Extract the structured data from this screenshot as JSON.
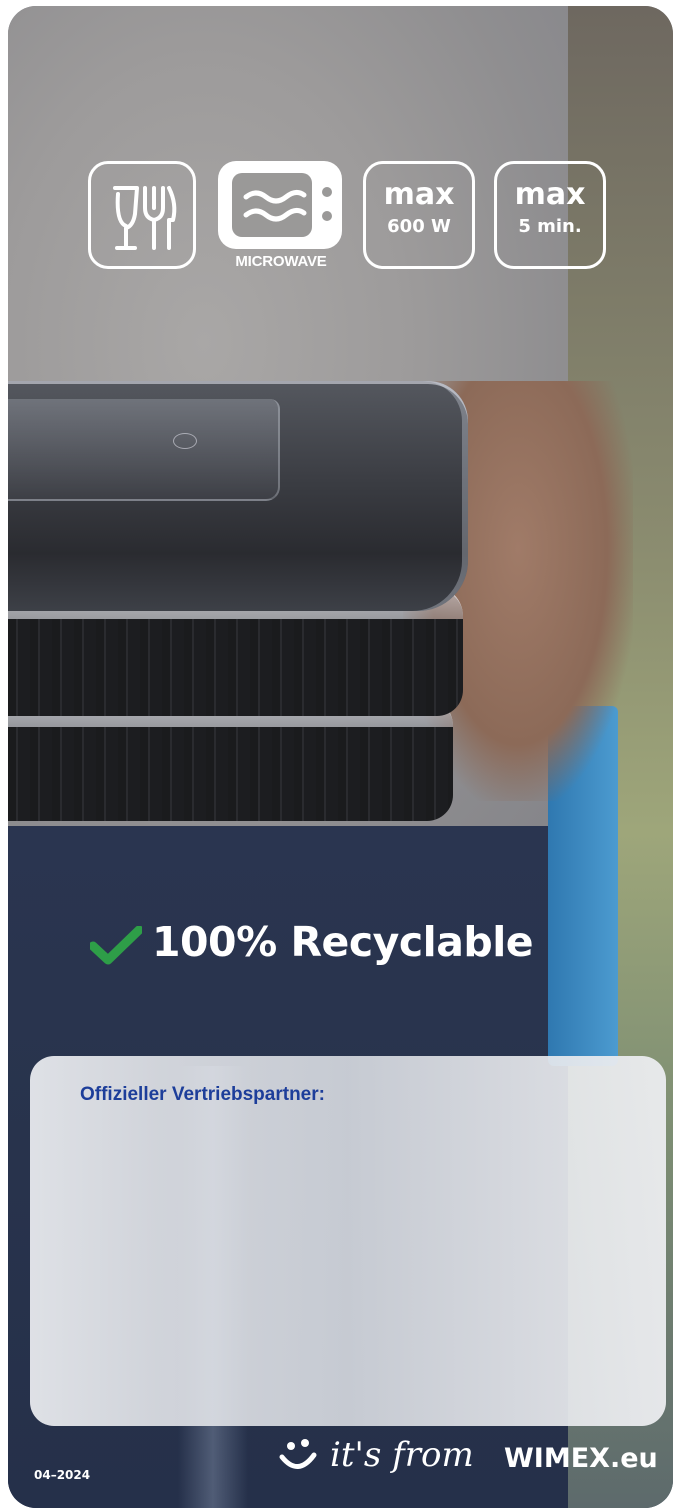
{
  "icons": {
    "food_safe": "fork-and-glass-icon",
    "microwave": "microwave-icon",
    "microwave_label": "MICROWAVE",
    "max_power_top": "max",
    "max_power_bottom": "600 W",
    "max_time_top": "max",
    "max_time_bottom": "5 min."
  },
  "recycle": {
    "icon": "checkmark-icon",
    "check_color": "#2e9e48",
    "label": "100% Recyclable"
  },
  "partner": {
    "label": "Offizieller Vertriebspartner:",
    "label_color": "#1d3e9a"
  },
  "footer": {
    "date_code": "04–2024",
    "brand_icon": "smile-icon",
    "brand_script": "it's from",
    "brand_name": "WIMEX.eu"
  }
}
